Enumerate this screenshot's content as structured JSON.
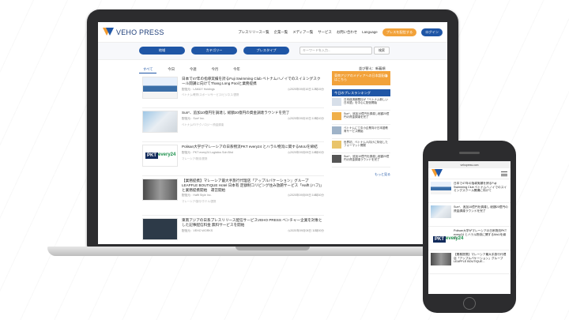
{
  "site": {
    "logo_text": "VEHO PRESS",
    "nav": [
      "プレスリリース一覧",
      "企業一覧",
      "メディア一覧",
      "サービス",
      "お問い合わせ",
      "Language"
    ],
    "cta_release": "プレスを配信する",
    "cta_login": "ログイン"
  },
  "filters": {
    "region": "地域",
    "category": "カテゴリー",
    "type": "プレスタイプ",
    "search_placeholder": "キーワードを入力...",
    "search_button": "検索"
  },
  "tabs": [
    "すべて",
    "今日",
    "今週",
    "今月",
    "今年"
  ],
  "sort_label": "並び替え：新着順",
  "articles": [
    {
      "title": "日本で47年の指導実績を誇るFuji Swimming Club ベトナムハノイでのスイミングスクール開講に向けてThang Long Poolと業務提携",
      "source": "配信元：LAMUY Holdings",
      "date": "◷2020年09月10日 12時15分",
      "sub": "ベトナム/教育/スポーツ/サービス/ビジネス/提携"
    },
    {
      "title": "Sun*、追加10億円を調達し 総額20億円の資金調達ラウンドを完了",
      "source": "配信元：Sun* Inc.",
      "date": "◷2020年09月10日 10時10分",
      "sub": "ベトナム/IT/テクノロジー/資金調達"
    },
    {
      "title": "Polisan大学がマレーシアの日系物流PKT every24 とハラル物流に関するMoUを締結",
      "source": "配信元：PKT every24 Logistics Sdn Bhd",
      "date": "◷2020年09月09日 18時00分",
      "sub": "マレーシア/物流/提携"
    },
    {
      "title": "【業務提携】マレーシア最大手旅行代理店「アップルバケーション」グループ LEAPFLE BOUTIQUE Hotel 日本有 定額制コリビング住み放題サービス「Hafft (ハフ)」と業務提携開始　運営開始",
      "source": "配信元：Hafft Style Inc.",
      "date": "◷2020年09月09日 16時30分",
      "sub": "マレーシア/旅行/ホテル/提携"
    },
    {
      "title": "東南アジアの日系プレスリリース配信サービスVEHO PRESS ベンチャー企業を対象とした記事配信料金 無料サービスを開始",
      "source": "配信元：VEHO WORKS",
      "date": "◷2020年09月08日 11時00分",
      "sub": "ベトナム/サービス"
    }
  ],
  "sidebar": {
    "banner": "東南アジアのメディアへの日本語配信はこちら",
    "ranking_title": "今日のプレスランキング",
    "ranking": [
      "日本経済新聞社が「ベトナム新しい日本語」を中心に配信開始",
      "Sun*、追加10億円を調達し総額20億円の資金調達を完了",
      "ベトナムにて中小企業向け日本語教育サービス開始",
      "世界初、ベトナム人向けに特化したフォーマット開発",
      "Sun*、追加10億円を調達し総額20億円の資金調達ラウンドを完了"
    ],
    "more": "もっと見る"
  },
  "phone": {
    "url": "vehopress.com",
    "articles": [
      "日本で47年の指導実績を誇るFuji Swimming Club ベトナムハノイでのスイミングスクール開講に向けて",
      "Sun*、追加10億円を調達し 総額20億円の資金調達ラウンドを完了",
      "Polisan大学がマレーシアの日系物流PKT every24 とハラル物流に関するMoUを締結",
      "【業務提携】マレーシア最大手旅行代理店「アップルバケーション」グループ LEAPFLE BOUTIQUE..."
    ]
  },
  "colors": {
    "brand_blue": "#1f56a6",
    "brand_orange": "#f2a23a"
  }
}
